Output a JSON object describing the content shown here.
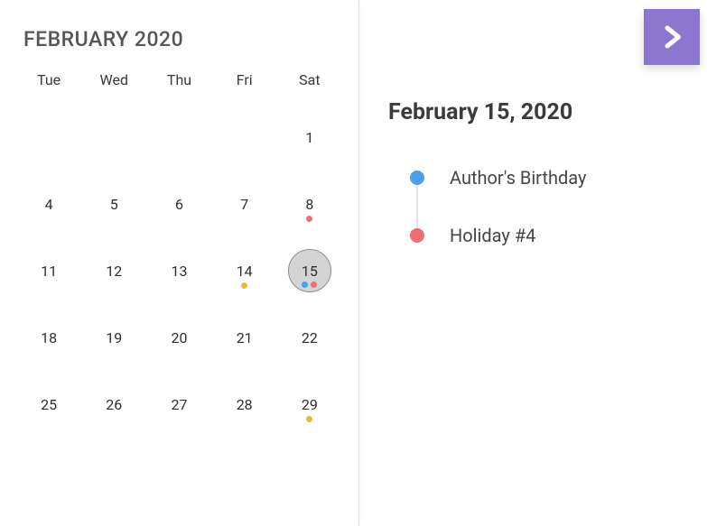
{
  "calendar": {
    "title": "FEBRUARY 2020",
    "dow": [
      "Tue",
      "Wed",
      "Thu",
      "Fri",
      "Sat"
    ],
    "weeks": [
      [
        null,
        null,
        null,
        null,
        {
          "n": 1
        }
      ],
      [
        {
          "n": 4
        },
        {
          "n": 5
        },
        {
          "n": 6
        },
        {
          "n": 7
        },
        {
          "n": 8,
          "dots": [
            "pink"
          ]
        }
      ],
      [
        {
          "n": 11
        },
        {
          "n": 12
        },
        {
          "n": 13
        },
        {
          "n": 14,
          "dots": [
            "yellow"
          ]
        },
        {
          "n": 15,
          "dots": [
            "blue",
            "pink"
          ],
          "selected": true
        }
      ],
      [
        {
          "n": 18
        },
        {
          "n": 19
        },
        {
          "n": 20
        },
        {
          "n": 21
        },
        {
          "n": 22
        }
      ],
      [
        {
          "n": 25
        },
        {
          "n": 26
        },
        {
          "n": 27
        },
        {
          "n": 28
        },
        {
          "n": 29,
          "dots": [
            "yellow"
          ]
        }
      ]
    ],
    "colors": {
      "blue": "#4f9ee8",
      "pink": "#ef6e74",
      "yellow": "#f2b82c",
      "accent": "#8b77cf"
    }
  },
  "details": {
    "date": "February 15, 2020",
    "events": [
      {
        "color": "blue",
        "title": "Author's Birthday"
      },
      {
        "color": "pink",
        "title": "Holiday #4"
      }
    ]
  }
}
